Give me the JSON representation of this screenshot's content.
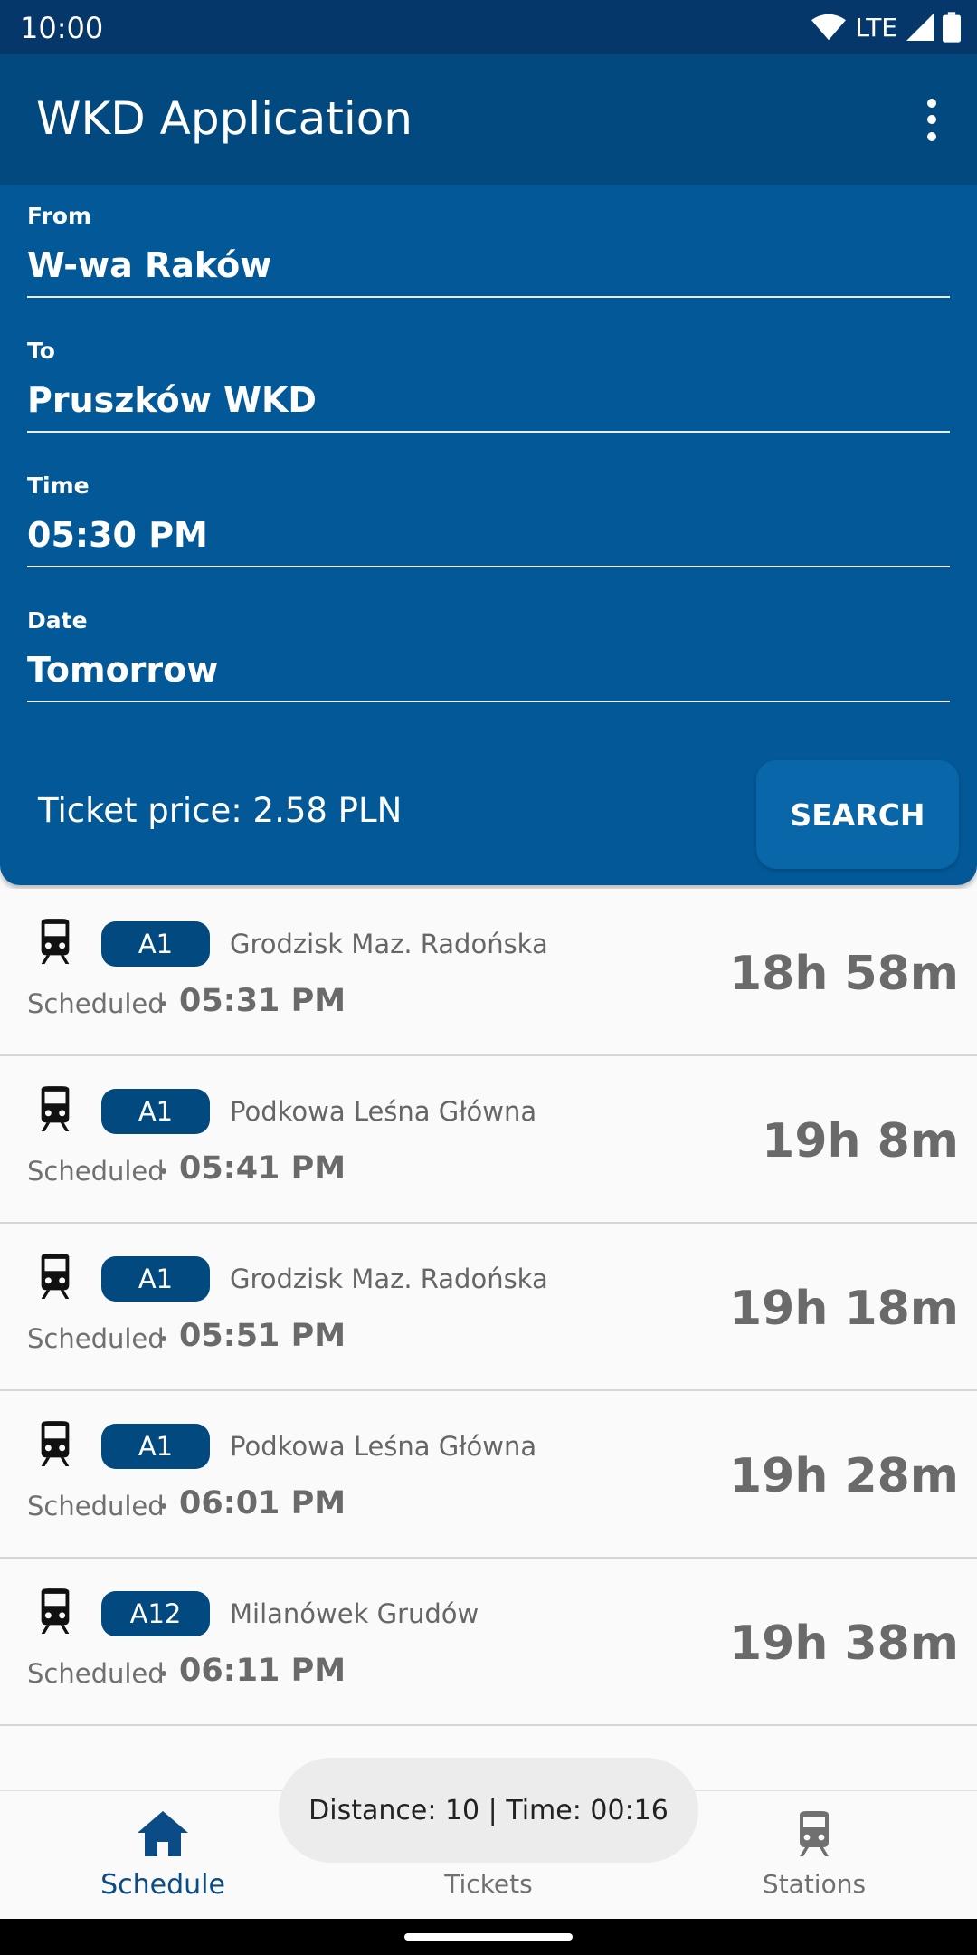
{
  "status_bar": {
    "time": "10:00",
    "network": "LTE"
  },
  "app_bar": {
    "title": "WKD Application",
    "menu_icon": "more-vert-icon"
  },
  "form": {
    "from": {
      "label": "From",
      "value": "W-wa Raków"
    },
    "to": {
      "label": "To",
      "value": "Pruszków WKD"
    },
    "time": {
      "label": "Time",
      "value": "05:30 PM"
    },
    "date": {
      "label": "Date",
      "value": "Tomorrow"
    },
    "ticket_price": "Ticket price: 2.58 PLN",
    "search_label": "SEARCH"
  },
  "connections": [
    {
      "line": "A1",
      "destination": "Grodzisk Maz. Radońska",
      "status": "Scheduled",
      "departure": "05:31 PM",
      "eta": "18h 58m"
    },
    {
      "line": "A1",
      "destination": "Podkowa Leśna Główna",
      "status": "Scheduled",
      "departure": "05:41 PM",
      "eta": "19h 8m"
    },
    {
      "line": "A1",
      "destination": "Grodzisk Maz. Radońska",
      "status": "Scheduled",
      "departure": "05:51 PM",
      "eta": "19h 18m"
    },
    {
      "line": "A1",
      "destination": "Podkowa Leśna Główna",
      "status": "Scheduled",
      "departure": "06:01 PM",
      "eta": "19h 28m"
    },
    {
      "line": "A12",
      "destination": "Milanówek Grudów",
      "status": "Scheduled",
      "departure": "06:11 PM",
      "eta": "19h 38m"
    }
  ],
  "bottom_nav": {
    "items": [
      {
        "label": "Schedule",
        "icon": "home-icon",
        "active": true
      },
      {
        "label": "Tickets",
        "icon": "dollar-icon",
        "active": false
      },
      {
        "label": "Stations",
        "icon": "train-icon",
        "active": false
      }
    ]
  },
  "toast": "Distance: 10 | Time: 00:16",
  "colors": {
    "primary": "#02497f",
    "panel": "#035997",
    "badge": "#02497f",
    "active_nav": "#0b4b86"
  }
}
